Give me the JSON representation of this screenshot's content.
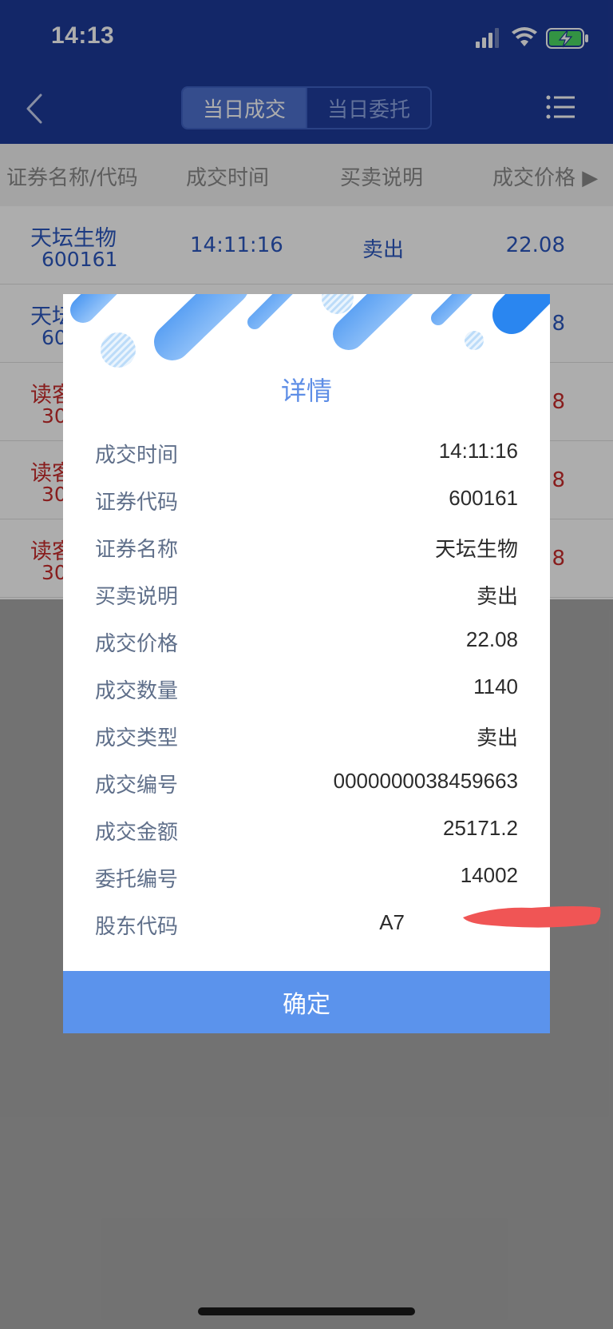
{
  "status": {
    "time": "14:13"
  },
  "header": {
    "tabs": [
      {
        "label": "当日成交",
        "active": true
      },
      {
        "label": "当日委托",
        "active": false
      }
    ]
  },
  "columns": [
    "证券名称/代码",
    "成交时间",
    "买卖说明",
    "成交价格 ▶"
  ],
  "rows": [
    {
      "name": "天坛生物",
      "code": "600161",
      "time": "14:11:16",
      "side": "卖出",
      "price": "22.08"
    },
    {
      "name": "天坛",
      "code": "60",
      "time": "",
      "side": "",
      "price": "8"
    },
    {
      "name": "读客",
      "code": "30",
      "time": "",
      "side": "",
      "price": "8"
    },
    {
      "name": "读客",
      "code": "30",
      "time": "",
      "side": "",
      "price": "8"
    },
    {
      "name": "读客",
      "code": "30",
      "time": "",
      "side": "",
      "price": "8"
    }
  ],
  "modal": {
    "title": "详情",
    "details": [
      {
        "label": "成交时间",
        "value": "14:11:16"
      },
      {
        "label": "证券代码",
        "value": "600161"
      },
      {
        "label": "证券名称",
        "value": "天坛生物"
      },
      {
        "label": "买卖说明",
        "value": "卖出"
      },
      {
        "label": "成交价格",
        "value": "22.08"
      },
      {
        "label": "成交数量",
        "value": "1140"
      },
      {
        "label": "成交类型",
        "value": "卖出"
      },
      {
        "label": "成交编号",
        "value": "0000000038459663"
      },
      {
        "label": "成交金额",
        "value": "25171.2"
      },
      {
        "label": "委托编号",
        "value": "14002"
      },
      {
        "label": "股东代码",
        "value": "A7"
      }
    ],
    "confirm_label": "确定"
  },
  "colors": {
    "header_bg": "#1d3a9a",
    "accent_blue": "#5b93ec",
    "sell_red": "#c92b2b",
    "buy_blue": "#2c58c0"
  },
  "icons": [
    "back-icon",
    "menu-list-icon",
    "signal-icon",
    "wifi-icon",
    "battery-charging-icon"
  ]
}
